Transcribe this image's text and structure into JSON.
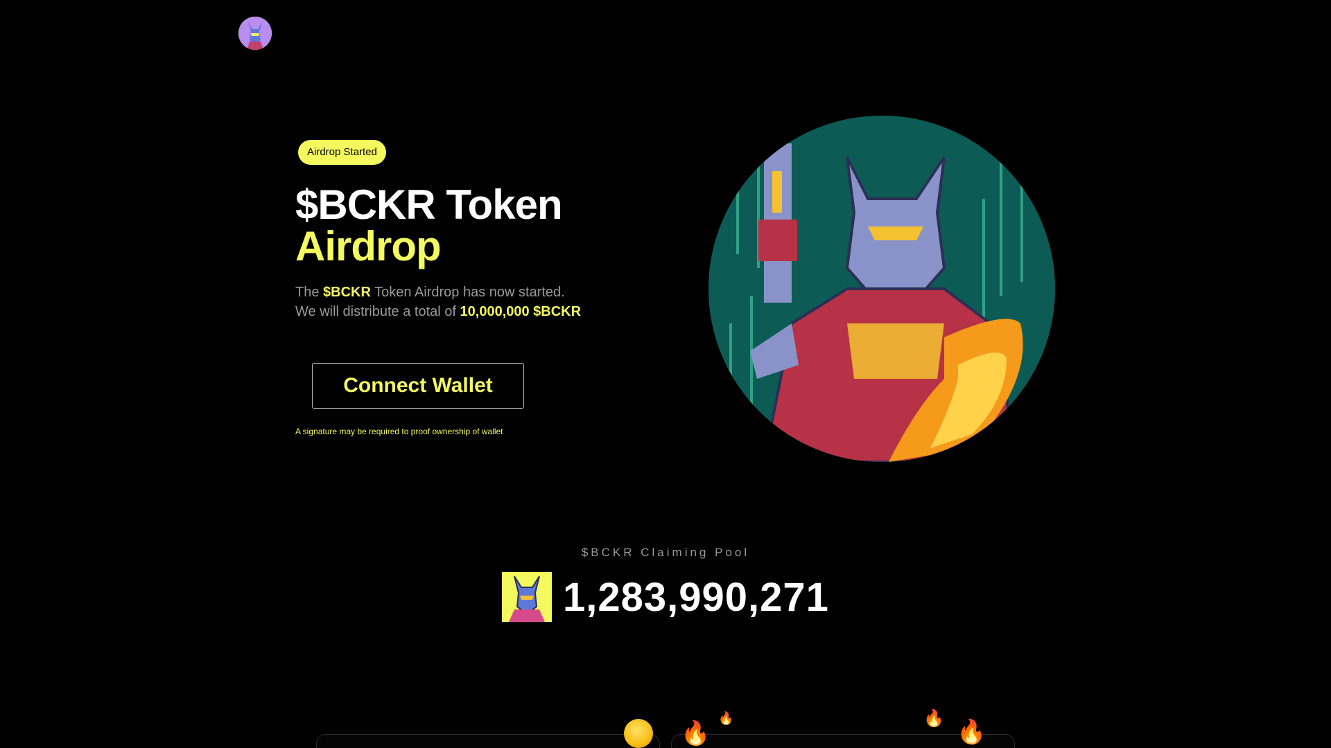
{
  "header": {
    "logo_icon": "avatar-logo-icon"
  },
  "hero": {
    "badge": "Airdrop Started",
    "title_line1": "$BCKR Token",
    "title_line2": "Airdrop",
    "desc_part1": "The ",
    "desc_token": "$BCKR",
    "desc_part2": " Token Airdrop has now started.",
    "desc_part3": "We will distribute a total of ",
    "desc_amount": "10,000,000 $BCKR",
    "connect_label": "Connect Wallet",
    "signature_note": "A signature may be required to proof ownership of wallet",
    "art_icon": "demon-knight-artwork"
  },
  "pool": {
    "label": "$BCKR Claiming Pool",
    "amount": "1,283,990,271",
    "avatar_icon": "knight-avatar-icon"
  },
  "colors": {
    "accent": "#f4f95e",
    "background": "#000000",
    "muted_text": "#9a9a9a",
    "art_bg": "#0d5b55"
  },
  "decor": {
    "coin_icon": "gold-coin-icon",
    "flame_icon": "fire-emoji-icon"
  }
}
